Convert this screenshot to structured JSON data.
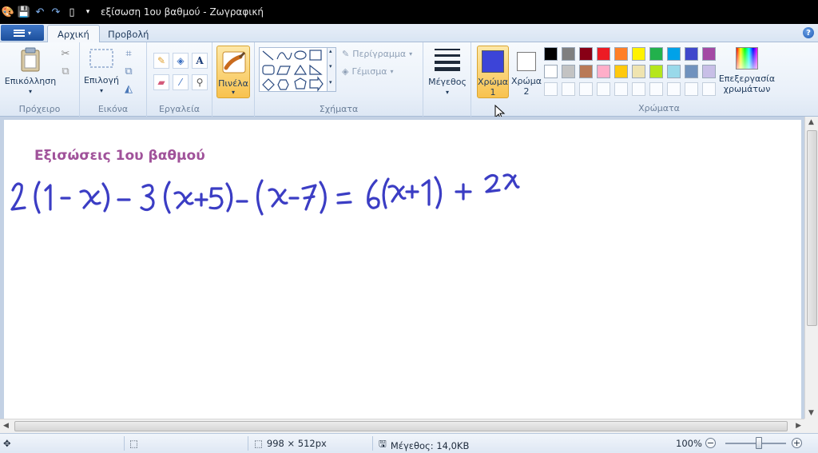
{
  "window": {
    "title": "εξίσωση 1ου βαθμού - Ζωγραφική"
  },
  "tabs": [
    {
      "label": "Αρχική",
      "active": true
    },
    {
      "label": "Προβολή",
      "active": false
    }
  ],
  "ribbon": {
    "clipboard": {
      "paste_label": "Επικόλληση",
      "group_label": "Πρόχειρο"
    },
    "image": {
      "select_label": "Επιλογή",
      "group_label": "Εικόνα"
    },
    "tools": {
      "group_label": "Εργαλεία"
    },
    "brushes": {
      "label": "Πινέλα"
    },
    "shapes": {
      "outline_label": "Περίγραμμα",
      "fill_label": "Γέμισμα",
      "group_label": "Σχήματα"
    },
    "size": {
      "label": "Μέγεθος"
    },
    "colors": {
      "color1_label_line1": "Χρώμα",
      "color1_label_line2": "1",
      "color2_label_line1": "Χρώμα",
      "color2_label_line2": "2",
      "edit_colors_line1": "Επεξεργασία",
      "edit_colors_line2": "χρωμάτων",
      "group_label": "Χρώματα",
      "color1": "#3c44d8",
      "color2": "#ffffff",
      "palette_row1": [
        "#000000",
        "#7f7f7f",
        "#880015",
        "#ed1c24",
        "#ff7f27",
        "#fff200",
        "#22b14c",
        "#00a2e8",
        "#3f48cc",
        "#a349a4"
      ],
      "palette_row2": [
        "#ffffff",
        "#c3c3c3",
        "#b97a57",
        "#ffaec9",
        "#ffc90e",
        "#efe4b0",
        "#b5e61d",
        "#99d9ea",
        "#7092be",
        "#c8bfe7"
      ]
    }
  },
  "canvas": {
    "heading": "Εξισώσεις 1ου βαθμού",
    "heading_color": "#a0529a",
    "ink_color": "#3b3dc4"
  },
  "status": {
    "canvas_size": "998 × 512px",
    "file_size": "Μέγεθος: 14,0KB",
    "zoom": "100%"
  }
}
